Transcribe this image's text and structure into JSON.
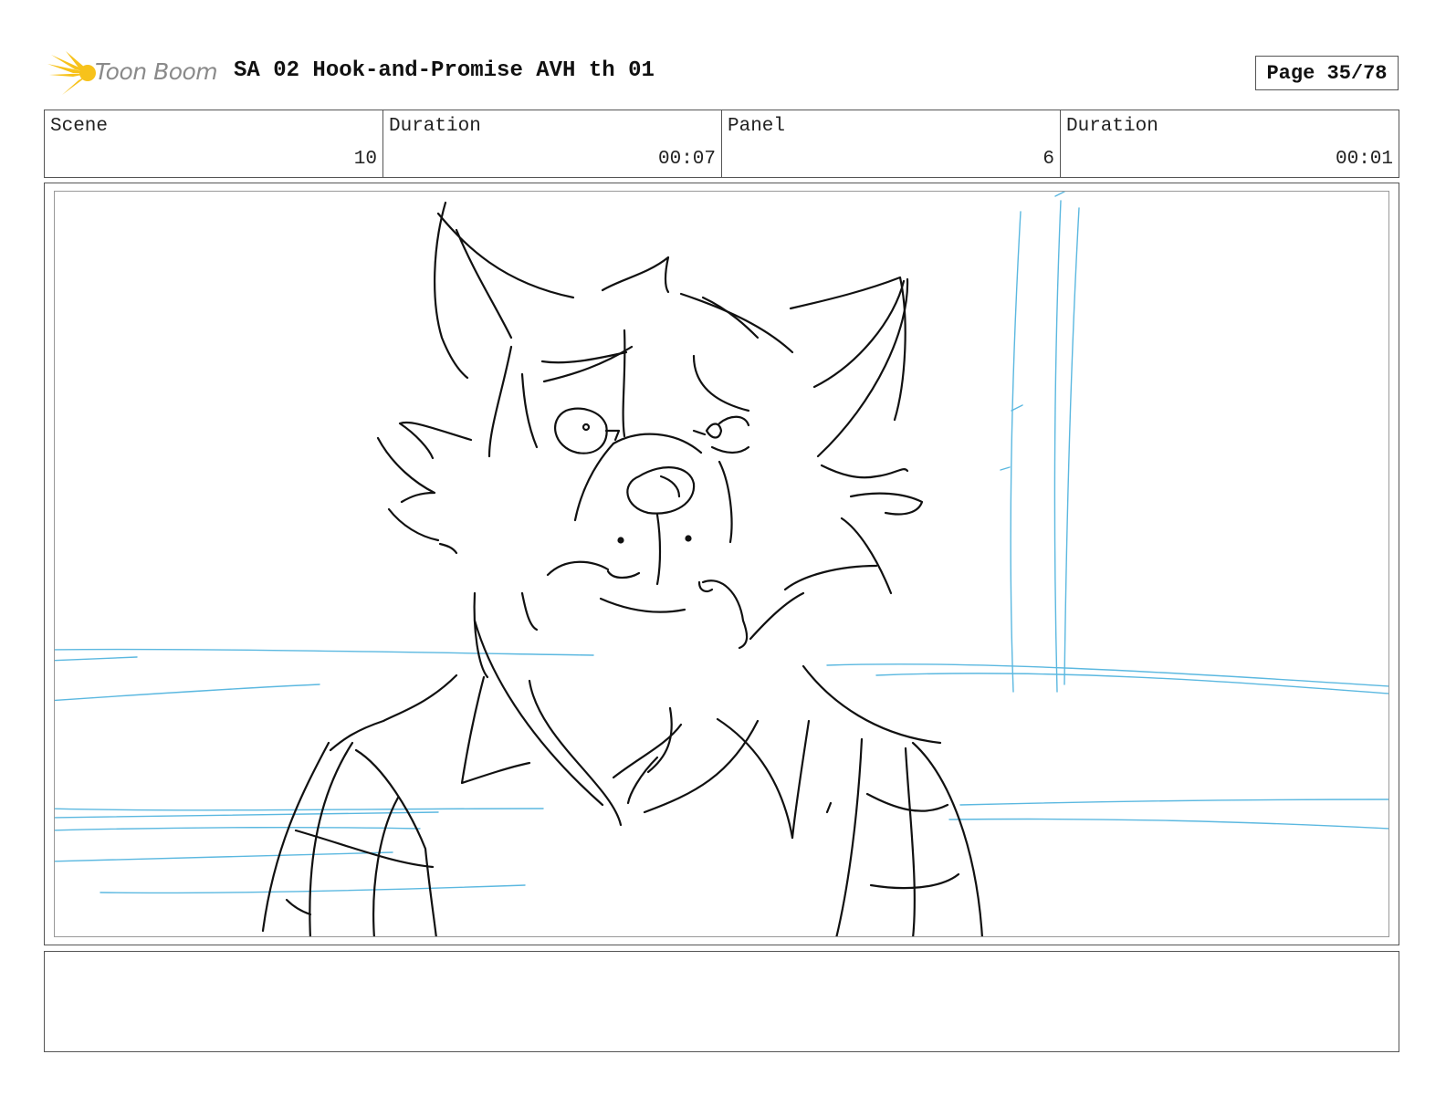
{
  "header": {
    "logo_text": "Toon Boom",
    "title": "SA 02 Hook-and-Promise AVH th 01",
    "page": "Page 35/78"
  },
  "info": {
    "scene_label": "Scene",
    "scene_value": "10",
    "scene_duration_label": "Duration",
    "scene_duration_value": "00:07",
    "panel_label": "Panel",
    "panel_value": "6",
    "panel_duration_label": "Duration",
    "panel_duration_value": "00:01"
  },
  "notes": {
    "text": ""
  },
  "colors": {
    "logo_yellow": "#f7c21b",
    "sketch_ink": "#111111",
    "background_lines": "#5bb8e0"
  }
}
